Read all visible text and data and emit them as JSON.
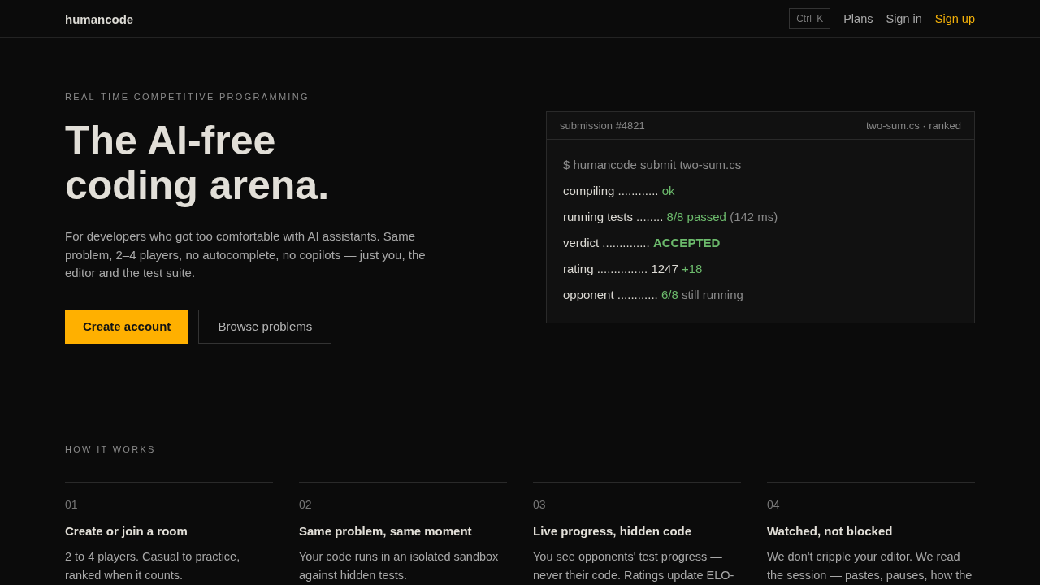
{
  "header": {
    "logo": "humancode",
    "shortcut": "Ctrl K",
    "nav": [
      {
        "label": "Plans",
        "kind": "link"
      },
      {
        "label": "Sign in",
        "kind": "link"
      },
      {
        "label": "Sign up",
        "kind": "accent"
      }
    ]
  },
  "hero": {
    "eyebrow": "REAL-TIME COMPETITIVE PROGRAMMING",
    "title": "The AI-free coding arena.",
    "description": "For developers who got too comfortable with AI assistants. Same problem, 2–4 players, no autocomplete, no copilots — just you, the editor and the test suite.",
    "buttons": [
      {
        "label": "Create account",
        "kind": "primary"
      },
      {
        "label": "Browse problems",
        "kind": "secondary"
      }
    ]
  },
  "submission": {
    "title": "submission #4821",
    "meta": "two-sum.cs · ranked",
    "command": "$ humancode submit two-sum.cs",
    "lines": [
      {
        "label": "compiling ............",
        "parts": [
          {
            "text": "ok",
            "kind": "pass"
          }
        ]
      },
      {
        "label": "running tests ........",
        "parts": [
          {
            "text": "8/8 passed",
            "kind": "pass"
          },
          {
            "text": "(142 ms)",
            "kind": "note"
          }
        ]
      },
      {
        "label": "verdict ..............",
        "parts": [
          {
            "text": "ACCEPTED",
            "kind": "verdict"
          }
        ]
      },
      {
        "label": "rating ...............",
        "parts": [
          {
            "text": "1247",
            "kind": "value"
          },
          {
            "text": "+18",
            "kind": "pass"
          }
        ]
      },
      {
        "label": "opponent ............",
        "parts": [
          {
            "text": "6/8",
            "kind": "pass"
          },
          {
            "text": "still running",
            "kind": "note"
          }
        ]
      }
    ]
  },
  "how_it_works": {
    "heading": "HOW IT WORKS",
    "steps": [
      {
        "number": "01",
        "title": "Create or join a room",
        "body": "2 to 4 players. Casual to practice, ranked when it counts."
      },
      {
        "number": "02",
        "title": "Same problem, same moment",
        "body": "Your code runs in an isolated sandbox against hidden tests."
      },
      {
        "number": "03",
        "title": "Live progress, hidden code",
        "body": "You see opponents' test progress — never their code. Ratings update ELO-"
      },
      {
        "number": "04",
        "title": "Watched, not blocked",
        "body": "We don't cripple your editor. We read the session — pastes, pauses, how the"
      }
    ]
  }
}
